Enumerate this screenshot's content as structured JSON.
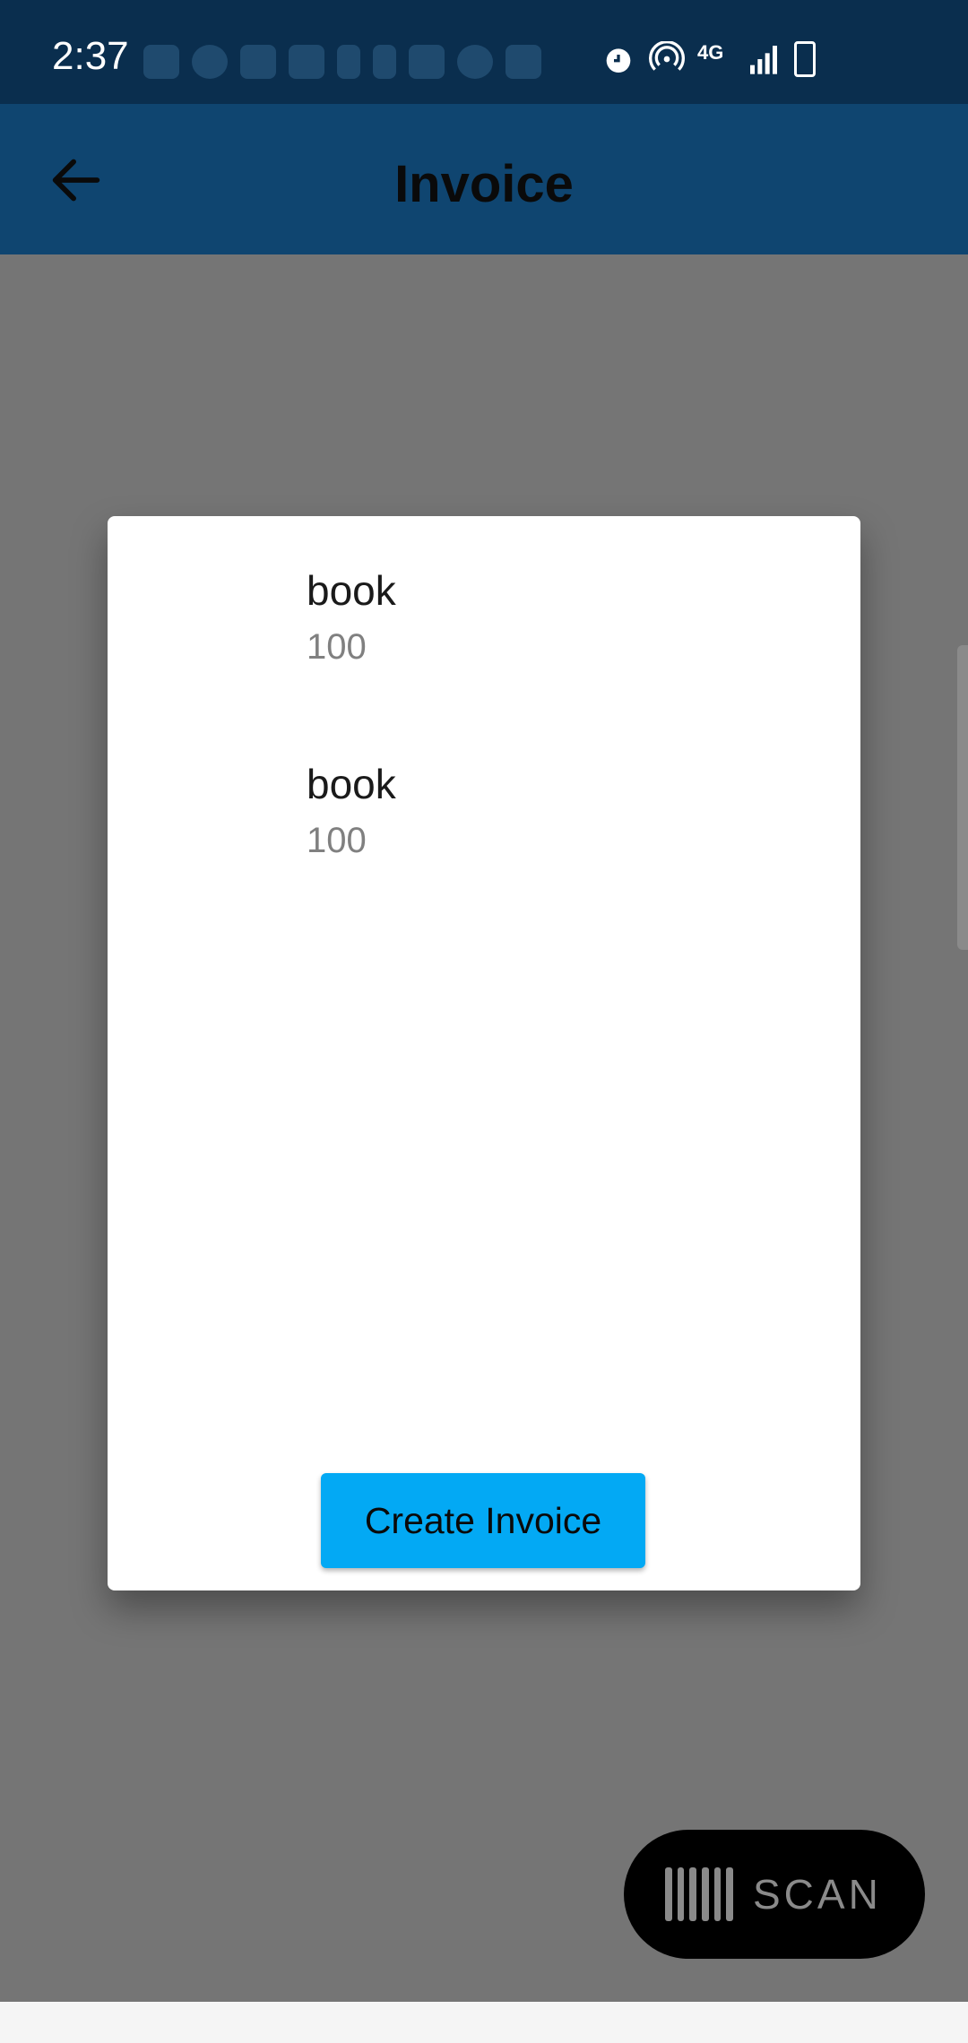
{
  "status_bar": {
    "time": "2:37",
    "network": "4G",
    "notification_icons": [
      "message-icon",
      "whatsapp-icon",
      "youtube-icon",
      "linkedin-icon",
      "bing-icon",
      "netflix-icon",
      "mail-icon",
      "sync-icon",
      "warning-icon"
    ],
    "system_icons": [
      "alarm-icon",
      "hotspot-icon",
      "network-4g-icon",
      "signal-icon",
      "battery-charging-icon"
    ]
  },
  "app_bar": {
    "title": "Invoice",
    "back_icon": "arrow-left-icon"
  },
  "dialog": {
    "items": [
      {
        "name": "book",
        "price": "100"
      },
      {
        "name": "book",
        "price": "100"
      }
    ],
    "create_button_label": "Create Invoice"
  },
  "fab": {
    "label": "SCAN",
    "icon": "barcode-icon"
  },
  "colors": {
    "status_bar": "#0a2e4e",
    "app_bar": "#0f4570",
    "scrim": "#757575",
    "button": "#03a9f4",
    "fab": "#000000"
  }
}
